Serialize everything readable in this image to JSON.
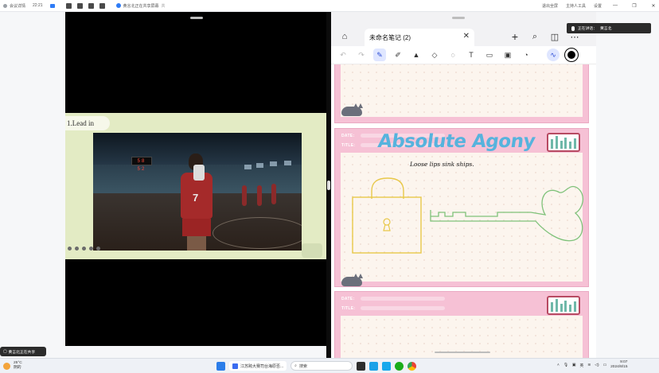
{
  "topbar": {
    "meeting_info": "会议详情",
    "time": "22:21",
    "share_status": "黄言北正在共享屏幕",
    "share_status_extra": "共",
    "right_items": [
      "退出全屏",
      "主持人工具",
      "设置"
    ],
    "icons": [
      "signal-icon",
      "layout-icon",
      "record-icon",
      "more-icon"
    ]
  },
  "slide": {
    "lead_in_label": "1.Lead in",
    "jersey_number": "7",
    "scoreboard": "58 52"
  },
  "notes": {
    "tab_title": "未命名笔记 (2)",
    "header_icons": [
      "home-icon",
      "add-icon",
      "search-icon",
      "sidebar-icon",
      "more-icon"
    ],
    "toolbar_tools": [
      {
        "name": "undo-icon",
        "glyph": "↶"
      },
      {
        "name": "redo-icon",
        "glyph": "↷"
      },
      {
        "name": "pen-icon",
        "glyph": "✎"
      },
      {
        "name": "pencil-icon",
        "glyph": "✐"
      },
      {
        "name": "marker-icon",
        "glyph": "▲"
      },
      {
        "name": "eraser-icon",
        "glyph": "◇"
      },
      {
        "name": "lasso-icon",
        "glyph": "◌"
      },
      {
        "name": "text-icon",
        "glyph": "T"
      },
      {
        "name": "shape-icon",
        "glyph": "▭"
      },
      {
        "name": "image-icon",
        "glyph": "▣"
      },
      {
        "name": "sticker-icon",
        "glyph": "◔"
      }
    ],
    "page_field_date": "DATE:",
    "page_field_title": "TITLE:",
    "headline": "Absolute Agony",
    "subline": "Loose lips sink ships."
  },
  "speaking_badge": {
    "label": "正在讲话：",
    "name": "黄言北"
  },
  "share_banner": "黄言北正在共享",
  "taskbar": {
    "weather_temp": "25°C",
    "weather_desc": "阴的",
    "search_placeholder": "搜索",
    "active_app_label": "江苏跨大赛司台海原否...",
    "time": "9:07",
    "date": "2024/8/15"
  },
  "colors": {
    "accent": "#2a4bd4",
    "headline": "#56b3dd",
    "page_border": "#f6c1d5",
    "lock_yellow": "#e8c84a",
    "key_green": "#7fc27a"
  }
}
